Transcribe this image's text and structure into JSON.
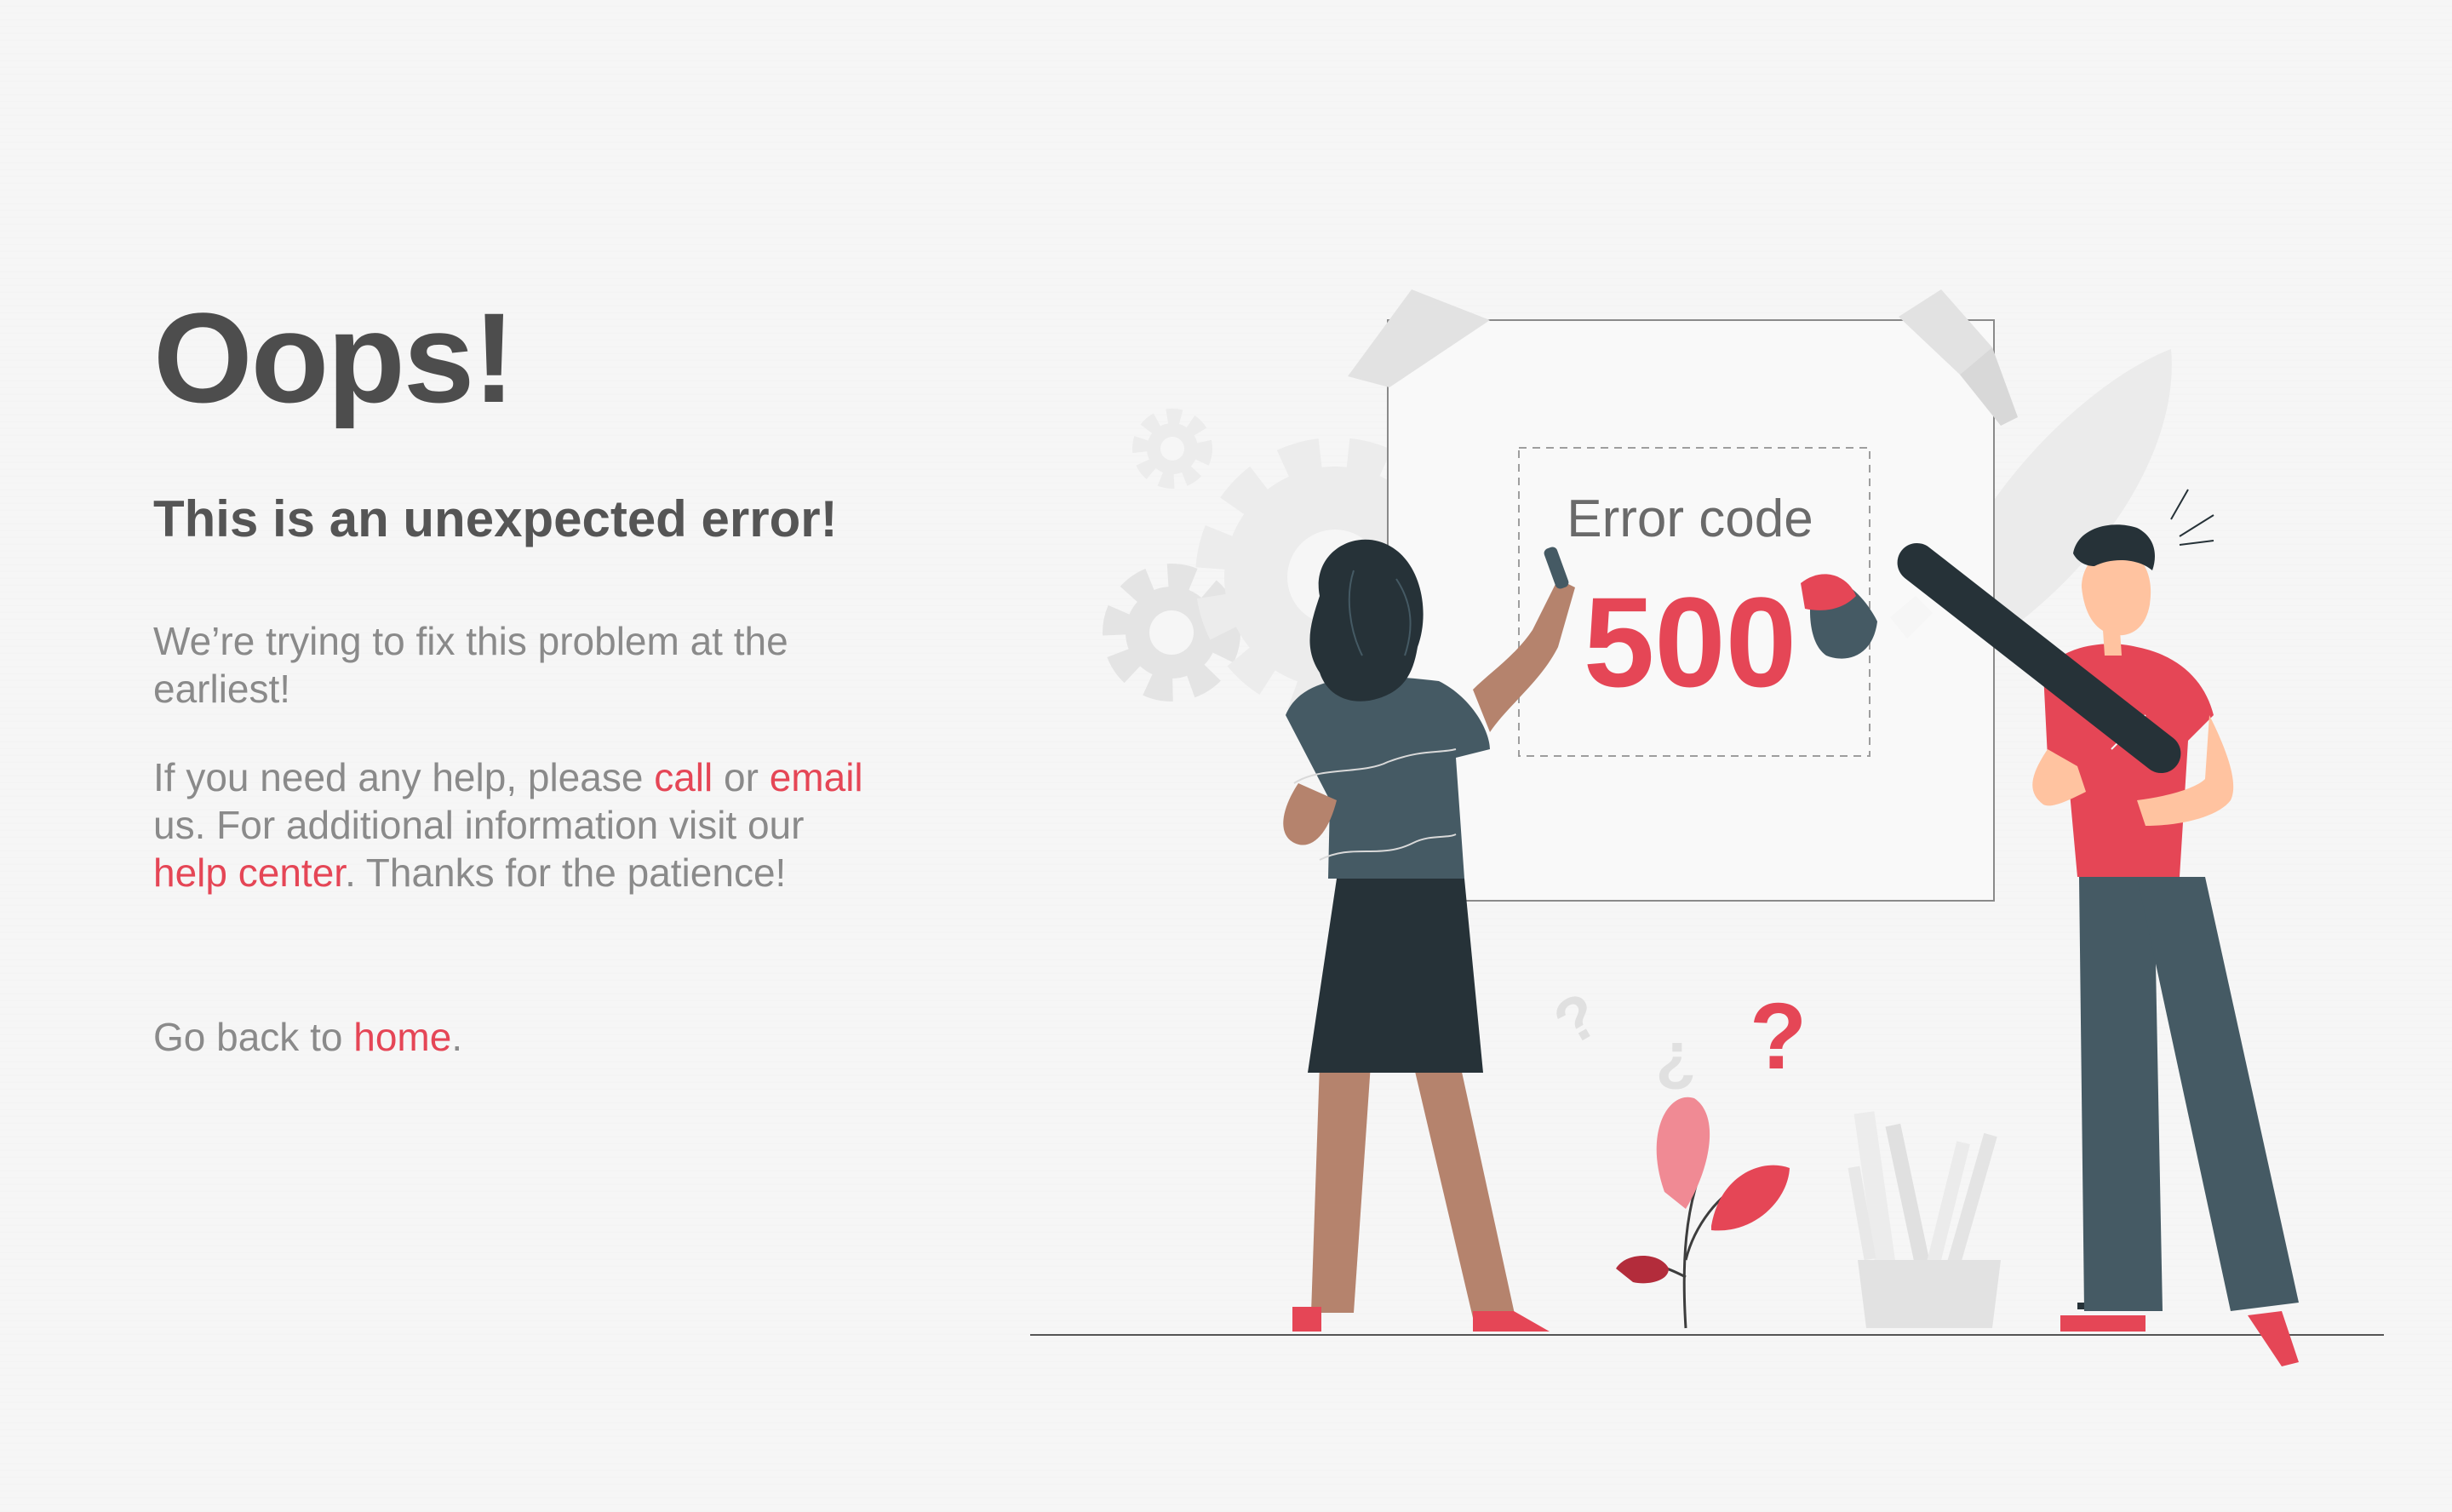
{
  "heading": "Oops!",
  "subheading": "This is an unexpected error!",
  "paragraph1": "We’re trying to fix this problem at the earliest!",
  "paragraph2": {
    "before_call": "If you need any help, please ",
    "call_link": "call",
    "between_call_email": " or ",
    "email_link": "email",
    "before_help": " us. For additional information visit our ",
    "help_link": "help center",
    "after_help": ". Thanks for the patience!"
  },
  "paragraph3": {
    "before_home": "Go back to ",
    "home_link": "home",
    "after_home": "."
  },
  "illustration": {
    "label": "Error code",
    "code": "500",
    "marks": [
      "?",
      "?",
      "?"
    ]
  },
  "colors": {
    "accent": "#e54656",
    "heading": "#4d4d4d",
    "body_text": "#8a8a8a",
    "dark_slate": "#455a64",
    "background": "#f6f6f6"
  }
}
